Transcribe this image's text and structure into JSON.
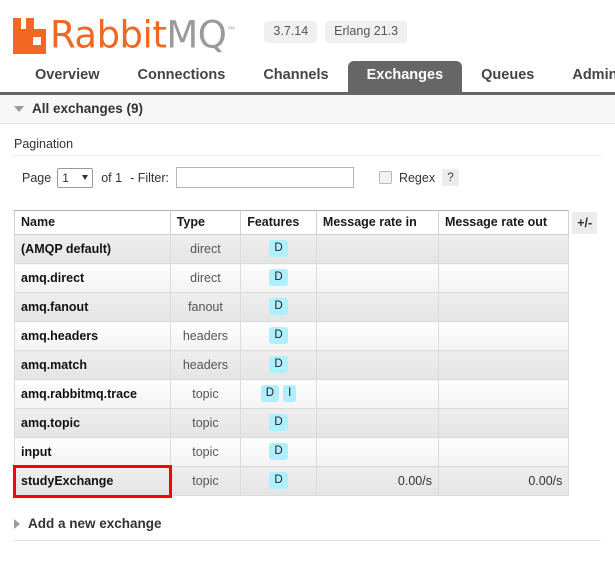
{
  "header": {
    "product_name_primary": "Rabbit",
    "product_name_secondary": "MQ",
    "trademark": "™",
    "version": "3.7.14",
    "erlang_version": "Erlang 21.3"
  },
  "nav": {
    "tabs": [
      {
        "label": "Overview",
        "active": false
      },
      {
        "label": "Connections",
        "active": false
      },
      {
        "label": "Channels",
        "active": false
      },
      {
        "label": "Exchanges",
        "active": true
      },
      {
        "label": "Queues",
        "active": false
      },
      {
        "label": "Admin",
        "active": false
      }
    ]
  },
  "section": {
    "title": "All exchanges (9)",
    "expanded": true
  },
  "pagination": {
    "label": "Pagination",
    "page_word": "Page",
    "page_value": "1",
    "of_text": "of 1",
    "filter_label": "- Filter:",
    "filter_value": "",
    "filter_placeholder": "",
    "regex_label": "Regex",
    "regex_checked": false,
    "help_label": "?"
  },
  "table": {
    "columns": [
      "Name",
      "Type",
      "Features",
      "Message rate in",
      "Message rate out"
    ],
    "toggle_columns_label": "+/-",
    "rows": [
      {
        "name": "(AMQP default)",
        "type": "direct",
        "features": [
          "D"
        ],
        "rate_in": "",
        "rate_out": "",
        "highlighted": false
      },
      {
        "name": "amq.direct",
        "type": "direct",
        "features": [
          "D"
        ],
        "rate_in": "",
        "rate_out": "",
        "highlighted": false
      },
      {
        "name": "amq.fanout",
        "type": "fanout",
        "features": [
          "D"
        ],
        "rate_in": "",
        "rate_out": "",
        "highlighted": false
      },
      {
        "name": "amq.headers",
        "type": "headers",
        "features": [
          "D"
        ],
        "rate_in": "",
        "rate_out": "",
        "highlighted": false
      },
      {
        "name": "amq.match",
        "type": "headers",
        "features": [
          "D"
        ],
        "rate_in": "",
        "rate_out": "",
        "highlighted": false
      },
      {
        "name": "amq.rabbitmq.trace",
        "type": "topic",
        "features": [
          "D",
          "I"
        ],
        "rate_in": "",
        "rate_out": "",
        "highlighted": false
      },
      {
        "name": "amq.topic",
        "type": "topic",
        "features": [
          "D"
        ],
        "rate_in": "",
        "rate_out": "",
        "highlighted": false
      },
      {
        "name": "input",
        "type": "topic",
        "features": [
          "D"
        ],
        "rate_in": "",
        "rate_out": "",
        "highlighted": false
      },
      {
        "name": "studyExchange",
        "type": "topic",
        "features": [
          "D"
        ],
        "rate_in": "0.00/s",
        "rate_out": "0.00/s",
        "highlighted": true
      }
    ]
  },
  "footer": {
    "add_new_label": "Add a new exchange",
    "expanded": false
  },
  "colors": {
    "brand_orange": "#f26722",
    "logo_gray": "#9a9a9a",
    "active_tab_bg": "#666666",
    "feature_badge_bg": "#aef0ff",
    "highlight_outline": "#ff0000"
  }
}
